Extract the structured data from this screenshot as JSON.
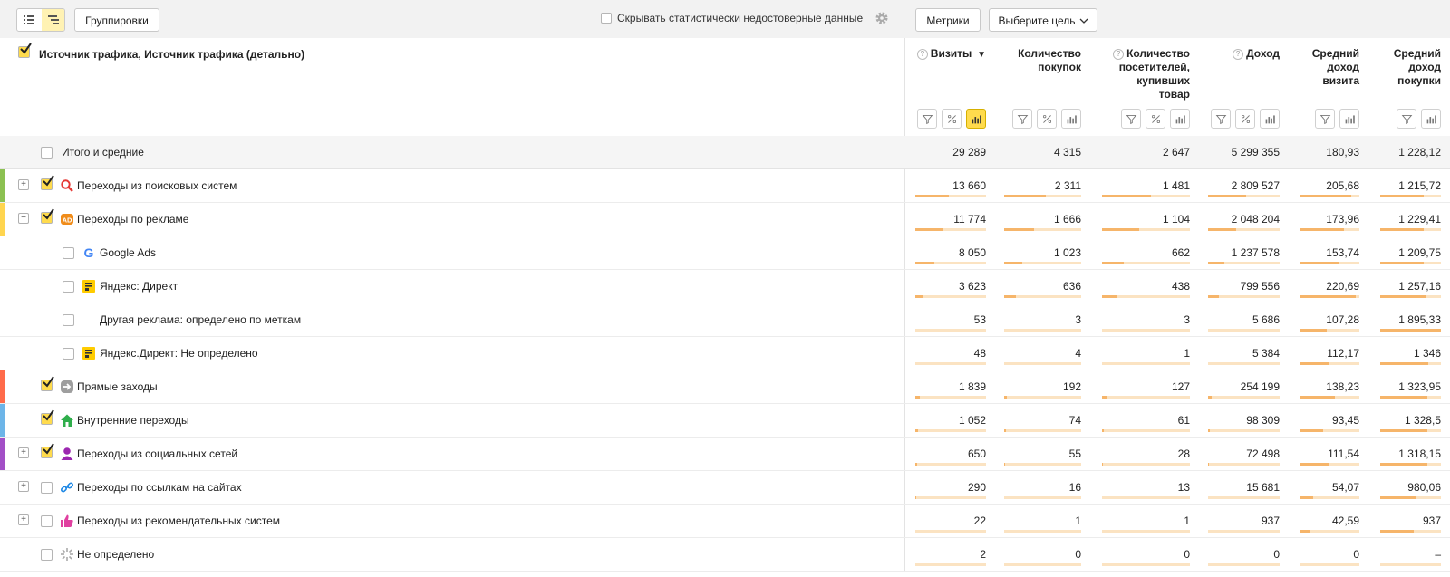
{
  "toolbar": {
    "groupings_label": "Группировки",
    "hide_unreliable_label": "Скрывать статистически недостоверные данные",
    "metrics_label": "Метрики",
    "goal_label": "Выберите цель"
  },
  "table": {
    "dimension_title": "Источник трафика, Источник трафика (детально)",
    "columns": [
      {
        "lines": [
          "Визиты"
        ],
        "help": true,
        "sort": "▼",
        "controls": [
          "filter",
          "percent",
          "chart"
        ],
        "active_chart": true
      },
      {
        "lines": [
          "Количество",
          "покупок"
        ],
        "help": false,
        "controls": [
          "filter",
          "percent",
          "chart"
        ],
        "active_chart": false
      },
      {
        "lines": [
          "Количество",
          "посетителей,",
          "купивших",
          "товар"
        ],
        "help": true,
        "controls": [
          "filter",
          "percent",
          "chart"
        ],
        "active_chart": false
      },
      {
        "lines": [
          "Доход"
        ],
        "help": true,
        "controls": [
          "filter",
          "percent",
          "chart"
        ],
        "active_chart": false
      },
      {
        "lines": [
          "Средний",
          "доход",
          "визита"
        ],
        "help": false,
        "controls": [
          "filter",
          "chart"
        ],
        "active_chart": false
      },
      {
        "lines": [
          "Средний",
          "доход",
          "покупки"
        ],
        "help": false,
        "controls": [
          "filter",
          "chart"
        ],
        "active_chart": false
      }
    ],
    "total": {
      "label": "Итого и средние",
      "values": [
        "29 289",
        "4 315",
        "2 647",
        "5 299 355",
        "180,93",
        "1 228,12"
      ]
    },
    "rows": [
      {
        "label": "Переходы из поисковых систем",
        "level": 0,
        "expander": "+",
        "checked": true,
        "icon": "search-icon",
        "stripe": "#8cc152",
        "values": [
          "13 660",
          "2 311",
          "1 481",
          "2 809 527",
          "205,68",
          "1 215,72"
        ],
        "bars": [
          0.47,
          0.54,
          0.56,
          0.53,
          0.87,
          0.71
        ]
      },
      {
        "label": "Переходы по рекламе",
        "level": 0,
        "expander": "−",
        "checked": true,
        "icon": "ad-icon",
        "stripe": "#ffd54f",
        "values": [
          "11 774",
          "1 666",
          "1 104",
          "2 048 204",
          "173,96",
          "1 229,41"
        ],
        "bars": [
          0.4,
          0.39,
          0.42,
          0.39,
          0.74,
          0.72
        ]
      },
      {
        "label": "Google Ads",
        "level": 1,
        "expander": "",
        "checked": false,
        "icon": "google-icon",
        "stripe": "",
        "values": [
          "8 050",
          "1 023",
          "662",
          "1 237 578",
          "153,74",
          "1 209,75"
        ],
        "bars": [
          0.27,
          0.24,
          0.25,
          0.23,
          0.65,
          0.71
        ]
      },
      {
        "label": "Яндекс: Директ",
        "level": 1,
        "expander": "",
        "checked": false,
        "icon": "yandex-direct-icon",
        "stripe": "",
        "values": [
          "3 623",
          "636",
          "438",
          "799 556",
          "220,69",
          "1 257,16"
        ],
        "bars": [
          0.12,
          0.15,
          0.17,
          0.15,
          0.94,
          0.74
        ]
      },
      {
        "label": "Другая реклама: определено по меткам",
        "level": 1,
        "expander": "",
        "checked": false,
        "icon": "",
        "stripe": "",
        "values": [
          "53",
          "3",
          "3",
          "5 686",
          "107,28",
          "1 895,33"
        ],
        "bars": [
          0.005,
          0.005,
          0.005,
          0.005,
          0.46,
          1.0
        ]
      },
      {
        "label": "Яндекс.Директ: Не определено",
        "level": 1,
        "expander": "",
        "checked": false,
        "icon": "yandex-direct-icon",
        "stripe": "",
        "values": [
          "48",
          "4",
          "1",
          "5 384",
          "112,17",
          "1 346"
        ],
        "bars": [
          0.005,
          0.005,
          0.005,
          0.005,
          0.48,
          0.79
        ]
      },
      {
        "label": "Прямые заходы",
        "level": 0,
        "expander": "",
        "checked": true,
        "icon": "direct-entry-icon",
        "stripe": "#ff6b4a",
        "values": [
          "1 839",
          "192",
          "127",
          "254 199",
          "138,23",
          "1 323,95"
        ],
        "bars": [
          0.06,
          0.04,
          0.05,
          0.05,
          0.59,
          0.78
        ]
      },
      {
        "label": "Внутренние переходы",
        "level": 0,
        "expander": "",
        "checked": true,
        "icon": "home-icon",
        "stripe": "#6db5e8",
        "values": [
          "1 052",
          "74",
          "61",
          "98 309",
          "93,45",
          "1 328,5"
        ],
        "bars": [
          0.04,
          0.02,
          0.02,
          0.02,
          0.4,
          0.78
        ]
      },
      {
        "label": "Переходы из социальных сетей",
        "level": 0,
        "expander": "+",
        "checked": true,
        "icon": "social-icon",
        "stripe": "#a24fc6",
        "values": [
          "650",
          "55",
          "28",
          "72 498",
          "111,54",
          "1 318,15"
        ],
        "bars": [
          0.02,
          0.01,
          0.01,
          0.01,
          0.48,
          0.78
        ]
      },
      {
        "label": "Переходы по ссылкам на сайтах",
        "level": 0,
        "expander": "+",
        "checked": false,
        "icon": "link-icon",
        "stripe": "",
        "values": [
          "290",
          "16",
          "13",
          "15 681",
          "54,07",
          "980,06"
        ],
        "bars": [
          0.01,
          0.005,
          0.005,
          0.005,
          0.23,
          0.58
        ]
      },
      {
        "label": "Переходы из рекомендательных систем",
        "level": 0,
        "expander": "+",
        "checked": false,
        "icon": "thumbs-up-icon",
        "stripe": "",
        "values": [
          "22",
          "1",
          "1",
          "937",
          "42,59",
          "937"
        ],
        "bars": [
          0.005,
          0.005,
          0.005,
          0.005,
          0.18,
          0.55
        ]
      },
      {
        "label": "Не определено",
        "level": 0,
        "expander": "",
        "checked": false,
        "icon": "undefined-icon",
        "stripe": "",
        "values": [
          "2",
          "0",
          "0",
          "0",
          "0",
          "–"
        ],
        "bars": [
          0,
          0,
          0,
          0,
          0,
          0
        ]
      }
    ]
  }
}
